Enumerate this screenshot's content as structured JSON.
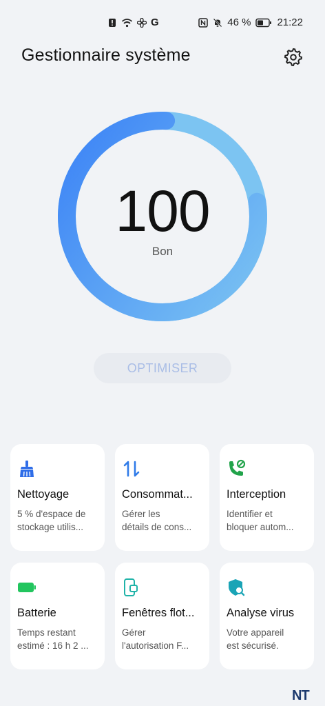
{
  "status_bar": {
    "carrier_letter": "G",
    "battery_percent": "46 %",
    "time": "21:22",
    "icons_left": [
      "alert-icon",
      "wifi-icon",
      "fan-icon"
    ],
    "icons_right": [
      "nfc-icon",
      "mute-icon",
      "battery-icon"
    ]
  },
  "header": {
    "title": "Gestionnaire système",
    "settings_icon": "gear-icon"
  },
  "gauge": {
    "score": "100",
    "label": "Bon",
    "fill_fraction": 1.0,
    "colors": {
      "start": "#3b82f6",
      "end": "#7cc4f2"
    }
  },
  "optimize_button": {
    "label": "OPTIMISER"
  },
  "cards": [
    {
      "icon": "broom-icon",
      "color": "#2f6de8",
      "title": "Nettoyage",
      "desc1": "5 % d'espace de",
      "desc2": "stockage utilis..."
    },
    {
      "icon": "transfer-arrows-icon",
      "color": "#2f7be8",
      "title": "Consommat...",
      "desc1": "Gérer les",
      "desc2": "détails de cons..."
    },
    {
      "icon": "phone-block-icon",
      "color": "#21a34a",
      "title": "Interception",
      "desc1": "Identifier et",
      "desc2": "bloquer autom..."
    },
    {
      "icon": "battery-icon",
      "color": "#22c55e",
      "title": "Batterie",
      "desc1": "Temps restant",
      "desc2": "estimé : 16 h 2 ..."
    },
    {
      "icon": "floating-window-icon",
      "color": "#1fb3a8",
      "title": "Fenêtres flot...",
      "desc1": "Gérer",
      "desc2": "l'autorisation F..."
    },
    {
      "icon": "shield-scan-icon",
      "color": "#1aa4b6",
      "title": "Analyse virus",
      "desc1": "Votre appareil",
      "desc2": "est sécurisé."
    }
  ],
  "watermark": "NT"
}
